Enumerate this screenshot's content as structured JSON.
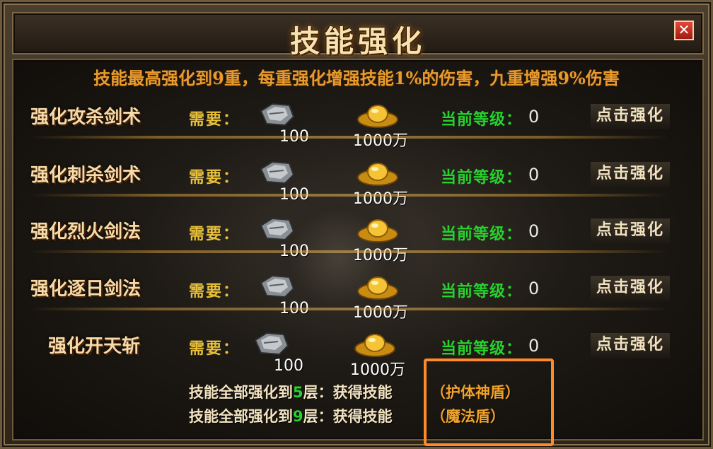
{
  "window": {
    "title": "技能强化",
    "close_label": "✕"
  },
  "intro": "技能最高强化到9重，每重强化增强技能1%的伤害，九重增强9%伤害",
  "common": {
    "need_label": "需要：",
    "level_label": "当前等级：",
    "enhance_label": "点击强化"
  },
  "skills": [
    {
      "name": "强化攻杀剑术",
      "ore": "100",
      "gold": "1000万",
      "level": "0"
    },
    {
      "name": "强化刺杀剑术",
      "ore": "100",
      "gold": "1000万",
      "level": "0"
    },
    {
      "name": "强化烈火剑法",
      "ore": "100",
      "gold": "1000万",
      "level": "0"
    },
    {
      "name": "强化逐日剑法",
      "ore": "100",
      "gold": "1000万",
      "level": "0"
    },
    {
      "name": "强化开天斩",
      "ore": "100",
      "gold": "1000万",
      "level": "0"
    }
  ],
  "bonuses": [
    {
      "prefix": "技能全部强化到",
      "layer": "5",
      "suffix": "层：获得技能",
      "reward": "（护体神盾）"
    },
    {
      "prefix": "技能全部强化到",
      "layer": "9",
      "suffix": "层：获得技能",
      "reward": "（魔法盾）"
    }
  ],
  "colors": {
    "highlight": "#ff8a2a",
    "level_green": "#27d22e",
    "reward_orange": "#f0a22a"
  }
}
